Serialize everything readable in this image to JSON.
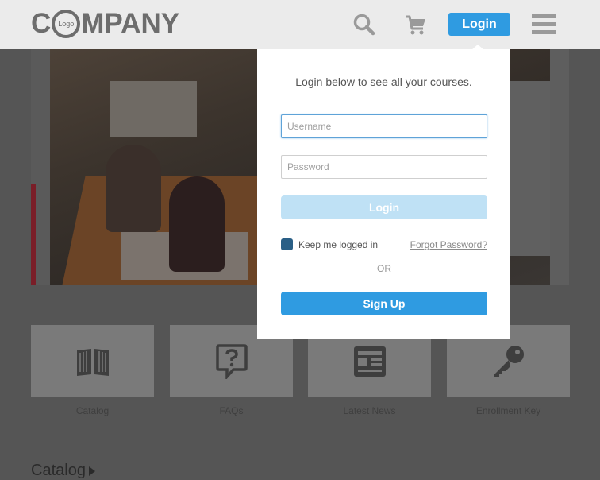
{
  "header": {
    "logo": {
      "first_letter": "C",
      "badge": "Logo",
      "rest": "MPANY"
    },
    "login_label": "Login",
    "icons": {
      "search": "search-icon",
      "cart": "cart-icon",
      "menu": "hamburger-menu-icon"
    }
  },
  "login_popover": {
    "message": "Login below to see all your courses.",
    "username_placeholder": "Username",
    "username_value": "",
    "password_placeholder": "Password",
    "password_value": "",
    "login_label": "Login",
    "keep_logged_in_label": "Keep me logged in",
    "keep_logged_in_checked": true,
    "forgot_password_label": "Forgot Password?",
    "or_label": "OR",
    "signup_label": "Sign Up"
  },
  "tiles": [
    {
      "label": "Catalog",
      "icon": "open-book-icon"
    },
    {
      "label": "FAQs",
      "icon": "question-bubble-icon"
    },
    {
      "label": "Latest News",
      "icon": "newspaper-icon"
    },
    {
      "label": "Enrollment Key",
      "icon": "key-icon"
    }
  ],
  "section": {
    "title": "Catalog"
  },
  "colors": {
    "accent": "#2f9be1",
    "accent_disabled": "#bfe1f5",
    "header_bg": "#ebebeb",
    "overlay_bg": "#555555"
  }
}
